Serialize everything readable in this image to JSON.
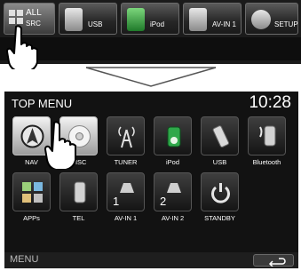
{
  "source_bar": {
    "items": [
      {
        "label_line1": "ALL",
        "label_line2": "SRC",
        "icon": "all-sources-grid-icon"
      },
      {
        "label": "USB",
        "icon": "usb-stick-icon"
      },
      {
        "label": "iPod",
        "icon": "ipod-icon"
      },
      {
        "label": "AV-IN 1",
        "icon": "av-input-icon"
      },
      {
        "label": "SETUP",
        "icon": "gear-icon"
      }
    ]
  },
  "top_menu": {
    "title": "TOP MENU",
    "clock": "10:28",
    "tiles_row1": [
      "NAV",
      "DISC",
      "TUNER",
      "iPod",
      "USB",
      "Bluetooth"
    ],
    "tiles_row2": [
      "APPs",
      "TEL",
      "AV-IN 1",
      "AV-IN 2",
      "STANDBY"
    ],
    "av_numbers": [
      "1",
      "2"
    ],
    "menu_label": "MENU",
    "back_icon": "return-arrow-icon"
  }
}
